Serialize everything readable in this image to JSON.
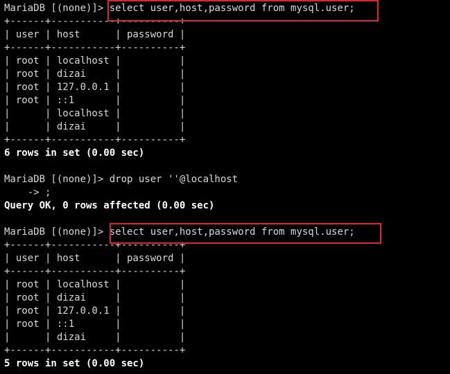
{
  "prompt": "MariaDB [(none)]> ",
  "colors": {
    "background": "#000000",
    "text": "#d8d8d8",
    "highlight": "#e0262d"
  },
  "block1": {
    "command": "select user,host,password from mysql.user;",
    "border": "+------+-----------+----------+",
    "header": "| user | host      | password |",
    "rows": [
      "| root | localhost |          |",
      "| root | dizai     |          |",
      "| root | 127.0.0.1 |          |",
      "| root | ::1       |          |",
      "|      | localhost |          |",
      "|      | dizai     |          |"
    ],
    "result": "6 rows in set (0.00 sec)"
  },
  "block2": {
    "command": "drop user ''@localhost",
    "continuation": "    -> ;",
    "result": "Query OK, 0 rows affected (0.00 sec)"
  },
  "block3": {
    "command": "select user,host,password from mysql.user;",
    "border": "+------+-----------+----------+",
    "header": "| user | host      | password |",
    "rows": [
      "| root | localhost |          |",
      "| root | dizai     |          |",
      "| root | 127.0.0.1 |          |",
      "| root | ::1       |          |",
      "|      | dizai     |          |"
    ],
    "result": "5 rows in set (0.00 sec)"
  }
}
